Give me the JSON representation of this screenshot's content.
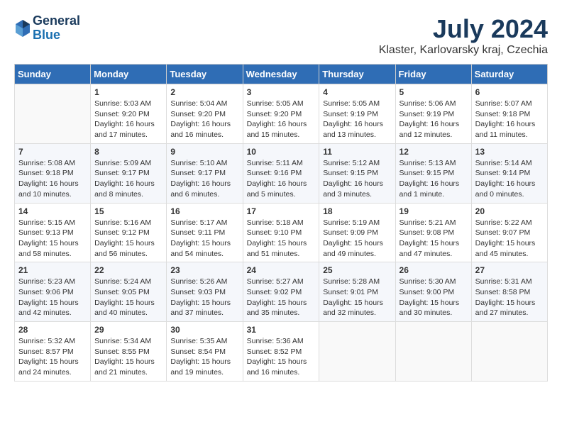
{
  "header": {
    "logo_line1": "General",
    "logo_line2": "Blue",
    "month": "July 2024",
    "location": "Klaster, Karlovarsky kraj, Czechia"
  },
  "columns": [
    "Sunday",
    "Monday",
    "Tuesday",
    "Wednesday",
    "Thursday",
    "Friday",
    "Saturday"
  ],
  "weeks": [
    [
      {
        "day": "",
        "content": ""
      },
      {
        "day": "1",
        "content": "Sunrise: 5:03 AM\nSunset: 9:20 PM\nDaylight: 16 hours\nand 17 minutes."
      },
      {
        "day": "2",
        "content": "Sunrise: 5:04 AM\nSunset: 9:20 PM\nDaylight: 16 hours\nand 16 minutes."
      },
      {
        "day": "3",
        "content": "Sunrise: 5:05 AM\nSunset: 9:20 PM\nDaylight: 16 hours\nand 15 minutes."
      },
      {
        "day": "4",
        "content": "Sunrise: 5:05 AM\nSunset: 9:19 PM\nDaylight: 16 hours\nand 13 minutes."
      },
      {
        "day": "5",
        "content": "Sunrise: 5:06 AM\nSunset: 9:19 PM\nDaylight: 16 hours\nand 12 minutes."
      },
      {
        "day": "6",
        "content": "Sunrise: 5:07 AM\nSunset: 9:18 PM\nDaylight: 16 hours\nand 11 minutes."
      }
    ],
    [
      {
        "day": "7",
        "content": "Sunrise: 5:08 AM\nSunset: 9:18 PM\nDaylight: 16 hours\nand 10 minutes."
      },
      {
        "day": "8",
        "content": "Sunrise: 5:09 AM\nSunset: 9:17 PM\nDaylight: 16 hours\nand 8 minutes."
      },
      {
        "day": "9",
        "content": "Sunrise: 5:10 AM\nSunset: 9:17 PM\nDaylight: 16 hours\nand 6 minutes."
      },
      {
        "day": "10",
        "content": "Sunrise: 5:11 AM\nSunset: 9:16 PM\nDaylight: 16 hours\nand 5 minutes."
      },
      {
        "day": "11",
        "content": "Sunrise: 5:12 AM\nSunset: 9:15 PM\nDaylight: 16 hours\nand 3 minutes."
      },
      {
        "day": "12",
        "content": "Sunrise: 5:13 AM\nSunset: 9:15 PM\nDaylight: 16 hours\nand 1 minute."
      },
      {
        "day": "13",
        "content": "Sunrise: 5:14 AM\nSunset: 9:14 PM\nDaylight: 16 hours\nand 0 minutes."
      }
    ],
    [
      {
        "day": "14",
        "content": "Sunrise: 5:15 AM\nSunset: 9:13 PM\nDaylight: 15 hours\nand 58 minutes."
      },
      {
        "day": "15",
        "content": "Sunrise: 5:16 AM\nSunset: 9:12 PM\nDaylight: 15 hours\nand 56 minutes."
      },
      {
        "day": "16",
        "content": "Sunrise: 5:17 AM\nSunset: 9:11 PM\nDaylight: 15 hours\nand 54 minutes."
      },
      {
        "day": "17",
        "content": "Sunrise: 5:18 AM\nSunset: 9:10 PM\nDaylight: 15 hours\nand 51 minutes."
      },
      {
        "day": "18",
        "content": "Sunrise: 5:19 AM\nSunset: 9:09 PM\nDaylight: 15 hours\nand 49 minutes."
      },
      {
        "day": "19",
        "content": "Sunrise: 5:21 AM\nSunset: 9:08 PM\nDaylight: 15 hours\nand 47 minutes."
      },
      {
        "day": "20",
        "content": "Sunrise: 5:22 AM\nSunset: 9:07 PM\nDaylight: 15 hours\nand 45 minutes."
      }
    ],
    [
      {
        "day": "21",
        "content": "Sunrise: 5:23 AM\nSunset: 9:06 PM\nDaylight: 15 hours\nand 42 minutes."
      },
      {
        "day": "22",
        "content": "Sunrise: 5:24 AM\nSunset: 9:05 PM\nDaylight: 15 hours\nand 40 minutes."
      },
      {
        "day": "23",
        "content": "Sunrise: 5:26 AM\nSunset: 9:03 PM\nDaylight: 15 hours\nand 37 minutes."
      },
      {
        "day": "24",
        "content": "Sunrise: 5:27 AM\nSunset: 9:02 PM\nDaylight: 15 hours\nand 35 minutes."
      },
      {
        "day": "25",
        "content": "Sunrise: 5:28 AM\nSunset: 9:01 PM\nDaylight: 15 hours\nand 32 minutes."
      },
      {
        "day": "26",
        "content": "Sunrise: 5:30 AM\nSunset: 9:00 PM\nDaylight: 15 hours\nand 30 minutes."
      },
      {
        "day": "27",
        "content": "Sunrise: 5:31 AM\nSunset: 8:58 PM\nDaylight: 15 hours\nand 27 minutes."
      }
    ],
    [
      {
        "day": "28",
        "content": "Sunrise: 5:32 AM\nSunset: 8:57 PM\nDaylight: 15 hours\nand 24 minutes."
      },
      {
        "day": "29",
        "content": "Sunrise: 5:34 AM\nSunset: 8:55 PM\nDaylight: 15 hours\nand 21 minutes."
      },
      {
        "day": "30",
        "content": "Sunrise: 5:35 AM\nSunset: 8:54 PM\nDaylight: 15 hours\nand 19 minutes."
      },
      {
        "day": "31",
        "content": "Sunrise: 5:36 AM\nSunset: 8:52 PM\nDaylight: 15 hours\nand 16 minutes."
      },
      {
        "day": "",
        "content": ""
      },
      {
        "day": "",
        "content": ""
      },
      {
        "day": "",
        "content": ""
      }
    ]
  ]
}
